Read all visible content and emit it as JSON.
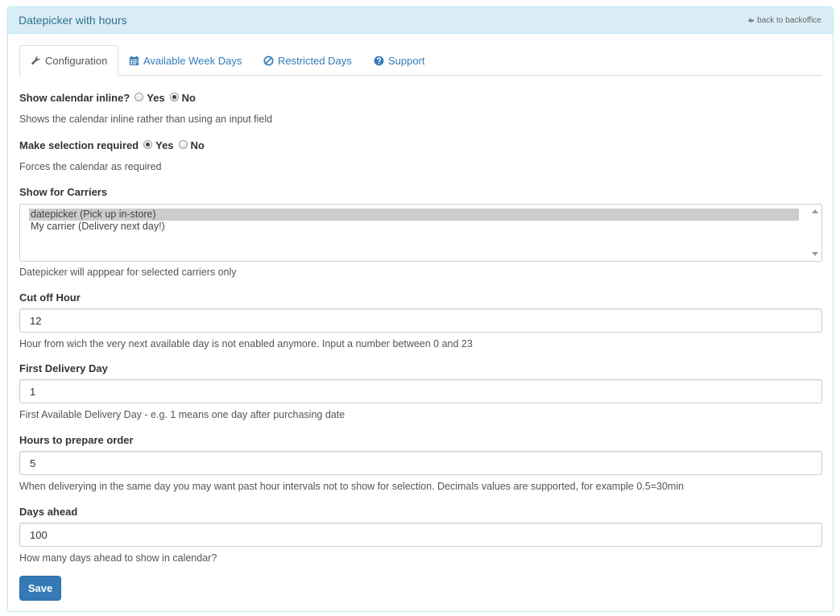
{
  "header": {
    "title": "Datepicker with hours",
    "back_label": "back to backoffice"
  },
  "tabs": [
    {
      "label": "Configuration",
      "icon": "wrench-icon",
      "active": true
    },
    {
      "label": "Available Week Days",
      "icon": "calendar-icon",
      "active": false
    },
    {
      "label": "Restricted Days",
      "icon": "ban-icon",
      "active": false
    },
    {
      "label": "Support",
      "icon": "question-circle-icon",
      "active": false
    }
  ],
  "form": {
    "inline": {
      "label": "Show calendar inline?",
      "yes": "Yes",
      "no": "No",
      "selected": "No",
      "help": "Shows the calendar inline rather than using an input field"
    },
    "required": {
      "label": "Make selection required",
      "yes": "Yes",
      "no": "No",
      "selected": "Yes",
      "help": "Forces the calendar as required"
    },
    "carriers": {
      "label": "Show for Carriers",
      "options": [
        "datepicker (Pick up in-store)",
        "My carrier (Delivery next day!)"
      ],
      "selected": "datepicker (Pick up in-store)",
      "help": "Datepicker will apppear for selected carriers only"
    },
    "cutoff": {
      "label": "Cut off Hour",
      "value": "12",
      "help": "Hour from wich the very next available day is not enabled anymore. Input a number between 0 and 23"
    },
    "first_day": {
      "label": "First Delivery Day",
      "value": "1",
      "help": "First Available Delivery Day - e.g. 1 means one day after purchasing date"
    },
    "prepare": {
      "label": "Hours to prepare order",
      "value": "5",
      "help": "When deliverying in the same day you may want past hour intervals not to show for selection. Decimals values are supported, for example 0.5=30min"
    },
    "days_ahead": {
      "label": "Days ahead",
      "value": "100",
      "help": "How many days ahead to show in calendar?"
    },
    "save_label": "Save"
  },
  "colors": {
    "primary": "#337ab7",
    "heading_bg": "#d9edf7",
    "heading_text": "#31708f"
  }
}
